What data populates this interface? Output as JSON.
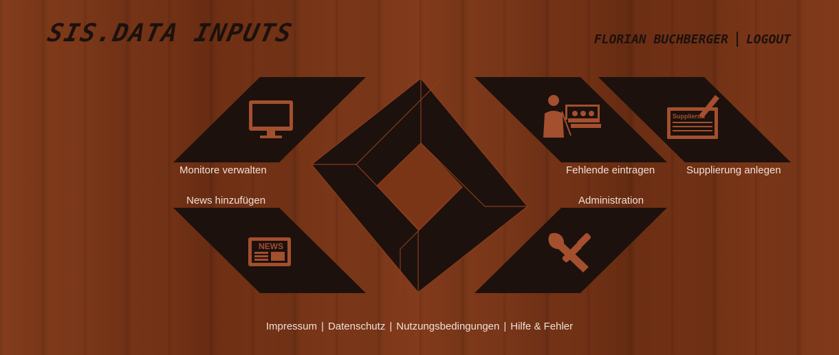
{
  "header": {
    "brand": "SIS.DATA INPUTS",
    "user_name": "FLORIAN BUCHBERGER",
    "logout_label": "LOGOUT"
  },
  "tiles": {
    "monitore": {
      "label": "Monitore verwalten",
      "icon": "monitor-icon"
    },
    "news": {
      "label": "News hinzufügen",
      "icon": "news-icon"
    },
    "fehlende": {
      "label": "Fehlende eintragen",
      "icon": "classroom-icon"
    },
    "supplierung": {
      "label": "Supplierung anlegen",
      "icon": "supplierung-board-icon",
      "icon_text": "Supplierun"
    },
    "administration": {
      "label": "Administration",
      "icon": "tools-icon"
    }
  },
  "footer": {
    "links": [
      "Impressum",
      "Datenschutz",
      "Nutzungsbedingungen",
      "Hilfe & Fehler"
    ]
  },
  "colors": {
    "wood": "#7a3416",
    "tile": "#1c110d",
    "icon": "#a44f2e",
    "text": "#f1e0d6"
  }
}
